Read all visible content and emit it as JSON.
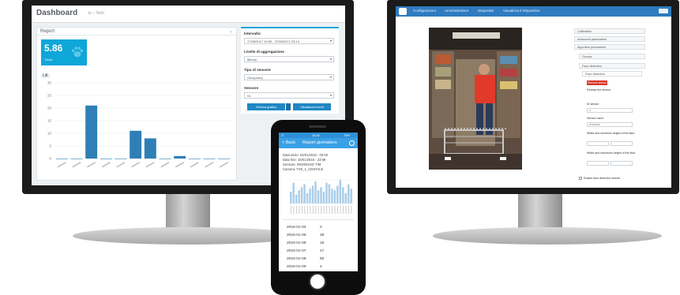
{
  "left_monitor": {
    "title": "Dashboard",
    "subtitle": "tv – Tech",
    "report": {
      "title": "Report",
      "kpi_value": "5.86",
      "kpi_label": "Totale",
      "tab_label": "Litt"
    },
    "filters": {
      "interval_label": "Intervallo:",
      "interval_value": "17/08/2017 19:05 - 27/08/2017 23:13",
      "aggregation_label": "Livello di aggregazione",
      "aggregation_value": "Minuto",
      "sensor_type_label": "Tipo di sensore",
      "sensor_type_value": "Occupancy",
      "sensor_label": "Sensore",
      "sensor_value": "S1",
      "graph_button": "Genera grafico",
      "events_button": "Visualizza eventi"
    },
    "chart_data": {
      "type": "bar",
      "categories": [
        "c1",
        "c2",
        "c3",
        "c4",
        "c5",
        "c6",
        "c7",
        "c8",
        "c9",
        "c10",
        "c11",
        "c12"
      ],
      "values": [
        0,
        0,
        21,
        0,
        0,
        11,
        8,
        0,
        1,
        0,
        0,
        0
      ],
      "ylim": [
        0,
        30
      ],
      "yticks": [
        0,
        5,
        10,
        15,
        20,
        25,
        30
      ],
      "grid": true,
      "color": "#2f7fb6"
    }
  },
  "right_monitor": {
    "nav": [
      "Configurazioni",
      "Amministratore",
      "Dispositivi",
      "Visualizza il Dispositivo"
    ],
    "config": {
      "calibration": "Calibration",
      "advanced": "Advanced parameters",
      "algorithm": "Algorithm parameters",
      "groups": "Groups",
      "face_detection": "Face detection",
      "face_detection_inner": "Face detection",
      "delete_button": "Remove sensor",
      "redraw": "Redraw the sensor",
      "id_sensor_label": "ID sensor",
      "id_sensor_value": "4",
      "sensor_name_label": "Sensor name",
      "sensor_name_value": "Id sensor",
      "width_label": "Width and minimum height of the face",
      "width_max_label": "Width and maximum height of the face",
      "enable_label": "Enable face detection events"
    }
  },
  "phone": {
    "status_time": "16:32",
    "status_carrier": "IT",
    "status_battery": "75%",
    "back_label": "< Back",
    "title": "Report giornaliero",
    "meta": {
      "start": "Data inizio: 04/01/2016 - 00:00",
      "end": "Data fine: 16/01/2016 - 23:59",
      "sensor": "Sensore: INGRESSO TIM",
      "camera": "Camera: TVE_1_CENTALE"
    },
    "chart_values": [
      8,
      14,
      6,
      9,
      11,
      13,
      7,
      10,
      12,
      15,
      9,
      11,
      8,
      14,
      13,
      10,
      9,
      12,
      16,
      11,
      7,
      13,
      10
    ],
    "rows": [
      {
        "date": "2016-01-04",
        "value": "0"
      },
      {
        "date": "2016-01-05",
        "value": "48"
      },
      {
        "date": "2016-01-06",
        "value": "16"
      },
      {
        "date": "2016-01-07",
        "value": "17"
      },
      {
        "date": "2016-01-08",
        "value": "60"
      },
      {
        "date": "2016-01-09",
        "value": "4"
      }
    ]
  },
  "colors": {
    "accent": "#0fa6d8",
    "nav_blue": "#2e7bbf",
    "phone_blue": "#3aa0e6",
    "bar_blue": "#2f7fb6",
    "danger": "#d9362b"
  }
}
